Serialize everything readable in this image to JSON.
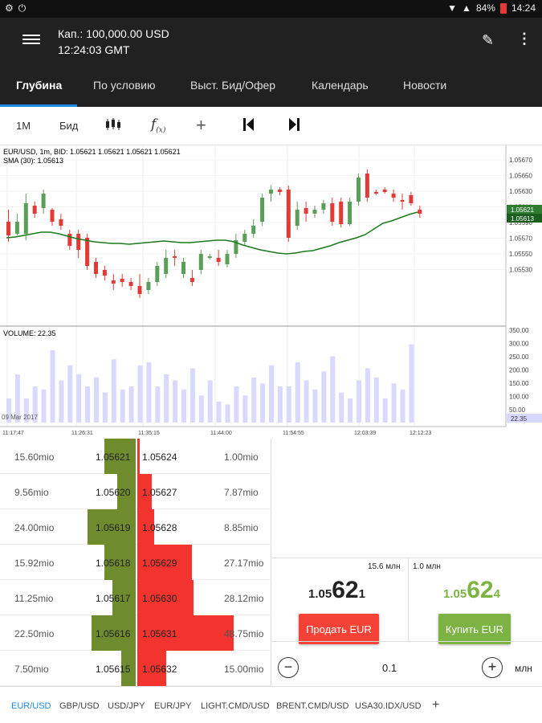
{
  "status_bar": {
    "battery": "84%",
    "time": "14:24"
  },
  "appbar": {
    "capital": "Кап.: 100,000.00 USD",
    "time": "12:24:03 GMT"
  },
  "tabs": [
    "Глубина",
    "По условию",
    "Выст. Бид/Офер",
    "Календарь",
    "Новости"
  ],
  "toolbar": {
    "period": "1M",
    "price_type": "Бид"
  },
  "chart": {
    "info_line1": "EUR/USD, 1m, BID: 1.05621 1.05621 1.05621 1.05621",
    "info_line2": "SMA (30): 1.05613",
    "price_ticks": [
      "1.05670",
      "1.05650",
      "1.05630",
      "1.05610",
      "1.05590",
      "1.05570",
      "1.05550",
      "1.05530"
    ],
    "last_price_tag": "1.05621",
    "sma_tag": "1.05613",
    "volume_label": "VOLUME: 22.35",
    "volume_ticks": [
      "350.00",
      "300.00",
      "250.00",
      "200.00",
      "150.00",
      "100.00",
      "50.00"
    ],
    "volume_tag": "22.35",
    "date_label": "09 Mar 2017",
    "time_ticks": [
      "11:17:47",
      "11:26:31",
      "11:35:15",
      "11:44:00",
      "11:54:55",
      "12:03:39",
      "12:12:23"
    ]
  },
  "order_book": [
    {
      "bid_vol": "15.60mio",
      "bid": "1.05621",
      "ask": "1.05624",
      "ask_vol": "1.00mio",
      "bid_frac": 0.15,
      "ask_frac": 0.01
    },
    {
      "bid_vol": "9.56mio",
      "bid": "1.05620",
      "ask": "1.05627",
      "ask_vol": "7.87mio",
      "bid_frac": 0.09,
      "ask_frac": 0.07
    },
    {
      "bid_vol": "24.00mio",
      "bid": "1.05619",
      "ask": "1.05628",
      "ask_vol": "8.85mio",
      "bid_frac": 0.23,
      "ask_frac": 0.08
    },
    {
      "bid_vol": "15.92mio",
      "bid": "1.05618",
      "ask": "1.05629",
      "ask_vol": "27.17mio",
      "bid_frac": 0.15,
      "ask_frac": 0.26
    },
    {
      "bid_vol": "11.25mio",
      "bid": "1.05617",
      "ask": "1.05630",
      "ask_vol": "28.12mio",
      "bid_frac": 0.11,
      "ask_frac": 0.27
    },
    {
      "bid_vol": "22.50mio",
      "bid": "1.05616",
      "ask": "1.05631",
      "ask_vol": "48.75mio",
      "bid_frac": 0.21,
      "ask_frac": 0.46
    },
    {
      "bid_vol": "7.50mio",
      "bid": "1.05615",
      "ask": "1.05632",
      "ask_vol": "15.00mio",
      "bid_frac": 0.07,
      "ask_frac": 0.14
    }
  ],
  "trade": {
    "sell_vol": "15.6 млн",
    "buy_vol": "1.0 млн",
    "sell_price_prefix": "1.05",
    "sell_price_big": "62",
    "sell_price_suffix": "1",
    "buy_price_prefix": "1.05",
    "buy_price_big": "62",
    "buy_price_suffix": "4",
    "sell_label": "Продать EUR",
    "buy_label": "Купить EUR",
    "amount": "0.1",
    "unit": "млн"
  },
  "symbols": [
    "EUR/USD",
    "GBP/USD",
    "USD/JPY",
    "EUR/JPY",
    "LIGHT.CMD/USD",
    "BRENT.CMD/USD",
    "USA30.IDX/USD"
  ],
  "colors": {
    "bid_green": "#6e8b2d",
    "ask_red": "#f2332e",
    "sell_btn": "#f44336",
    "buy_btn": "#7cb342",
    "accent": "#1e88e5"
  }
}
